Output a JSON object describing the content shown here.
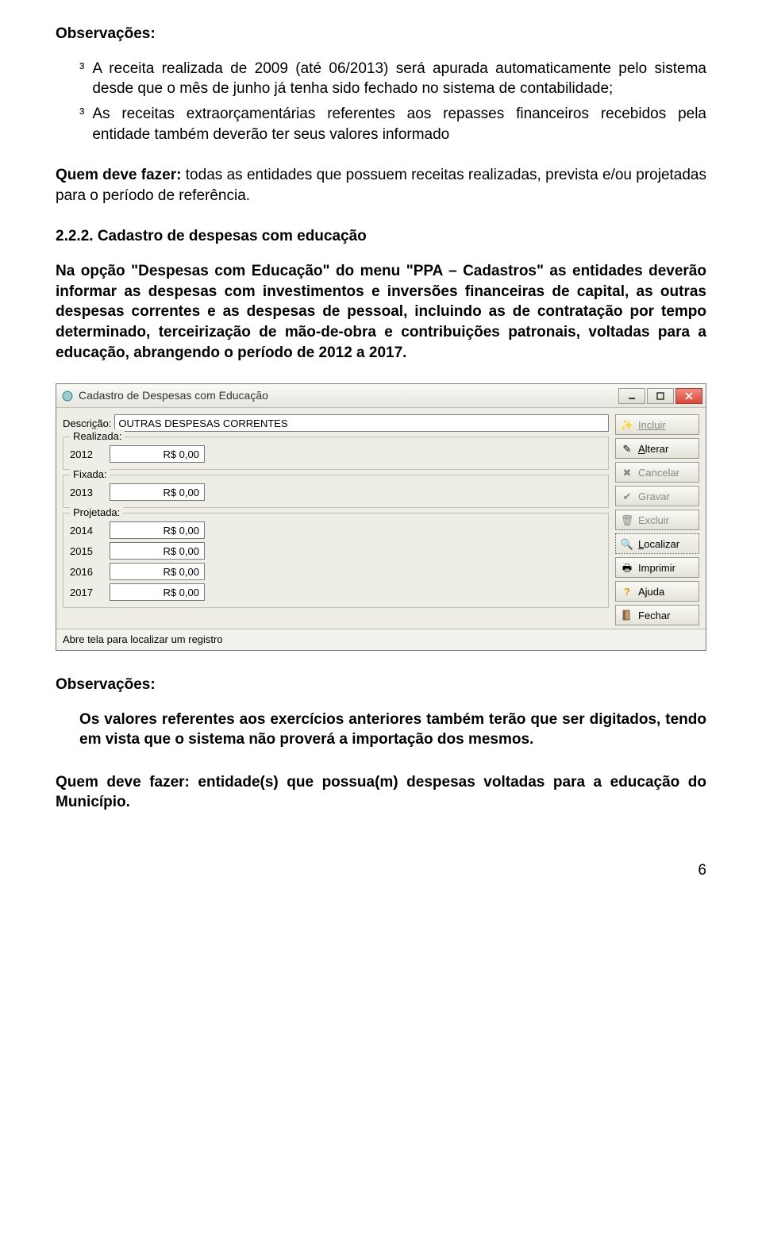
{
  "obs1_title": "Observações:",
  "bullets1": {
    "b1_marker": "³",
    "b1": "A receita realizada de 2009 (até 06/2013) será apurada automaticamente pelo sistema desde que o mês de junho já tenha sido fechado no sistema de contabilidade;",
    "b2_marker": "³",
    "b2": "As receitas extraorçamentárias referentes aos repasses financeiros recebidos pela entidade também deverão ter seus valores informado"
  },
  "quem1_prefix": "Quem deve fazer: ",
  "quem1_rest": "todas as entidades que possuem receitas realizadas, prevista e/ou projetadas para o período de referência.",
  "section_num": "2.2.2. Cadastro de despesas com educação",
  "main_para": "Na opção \"Despesas com Educação\" do menu \"PPA – Cadastros\" as entidades deverão informar as despesas com investimentos e inversões financeiras de capital, as outras despesas correntes e as despesas de pessoal, incluindo as de contratação por tempo determinado, terceirização de mão-de-obra e contribuições patronais, voltadas para a educação, abrangendo o período de 2012 a 2017.",
  "dialog": {
    "title": "Cadastro de Despesas com Educação",
    "descricao_label_pre": "Descri",
    "descricao_label_ul": "ç",
    "descricao_label_post": "ão:",
    "descricao_value": "OUTRAS DESPESAS CORRENTES",
    "realizada": {
      "legend": "Realizada:",
      "rows": [
        {
          "year": "2012",
          "value": "R$ 0,00"
        }
      ]
    },
    "fixada": {
      "legend": "Fixada:",
      "rows": [
        {
          "year": "2013",
          "value": "R$ 0,00"
        }
      ]
    },
    "projetada": {
      "legend": "Projetada:",
      "rows": [
        {
          "year": "2014",
          "value": "R$ 0,00"
        },
        {
          "year": "2015",
          "value": "R$ 0,00"
        },
        {
          "year": "2016",
          "value": "R$ 0,00"
        },
        {
          "year": "2017",
          "value": "R$ 0,00"
        }
      ]
    },
    "buttons": {
      "incluir": "Incluir",
      "alterar": "Alterar",
      "cancelar": "Cancelar",
      "gravar": "Gravar",
      "excluir": "Excluir",
      "localizar": "Localizar",
      "imprimir": "Imprimir",
      "ajuda": "Ajuda",
      "fechar": "Fechar"
    },
    "statusbar": "Abre tela para localizar um registro"
  },
  "obs2_title": "Observações:",
  "indent_para": "Os valores referentes aos exercícios anteriores também terão que ser digitados, tendo em vista que o sistema não proverá a importação dos mesmos.",
  "quem2_prefix": "Quem deve fazer: ",
  "quem2_rest": "entidade(s) que possua(m) despesas voltadas para a educação do Município.",
  "page_num": "6"
}
